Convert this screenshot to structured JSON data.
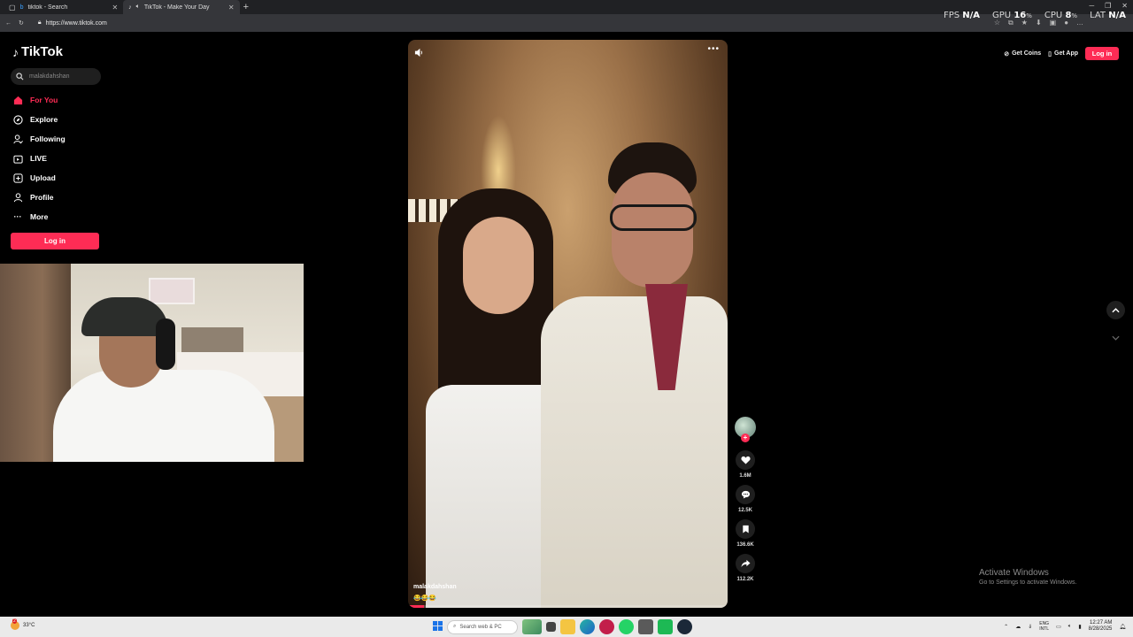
{
  "browser": {
    "tabs": [
      {
        "title": "tiktok - Search",
        "active": false
      },
      {
        "title": "TikTok - Make Your Day",
        "active": true
      }
    ],
    "url": "https://www.tiktok.com"
  },
  "overlay_stats": {
    "fps_label": "FPS",
    "fps_value": "N/A",
    "gpu_label": "GPU",
    "gpu_value": "16",
    "cpu_label": "CPU",
    "cpu_value": "8",
    "percent_unit": "%",
    "lat_label": "LAT",
    "lat_value": "N/A"
  },
  "tiktok": {
    "logo": "TikTok",
    "search_placeholder": "malakdahshan",
    "nav": [
      {
        "label": "For You",
        "icon": "home-icon",
        "active": true
      },
      {
        "label": "Explore",
        "icon": "compass-icon"
      },
      {
        "label": "Following",
        "icon": "following-icon"
      },
      {
        "label": "LIVE",
        "icon": "live-icon"
      },
      {
        "label": "Upload",
        "icon": "upload-icon"
      },
      {
        "label": "Profile",
        "icon": "profile-icon"
      },
      {
        "label": "More",
        "icon": "more-icon"
      }
    ],
    "login_label": "Log in",
    "top_right": {
      "get_coins": "Get Coins",
      "get_app": "Get App",
      "login": "Log in"
    }
  },
  "video": {
    "username": "malakdahshan",
    "caption_emoji": "😂😂😂",
    "progress": 0.05,
    "actions": {
      "likes": "1.6M",
      "comments": "12.5K",
      "saves": "136.6K",
      "shares": "112.2K"
    }
  },
  "watermark": {
    "line1": "Activate Windows",
    "line2": "Go to Settings to activate Windows."
  },
  "taskbar": {
    "badge": "2",
    "temperature": "33°C",
    "search_placeholder": "Search web & PC",
    "lang_top": "ENG",
    "lang_bottom": "INTL",
    "time": "12:27 AM",
    "date": "8/28/2025"
  },
  "colors": {
    "accent": "#fe2c55",
    "background": "#000000"
  }
}
